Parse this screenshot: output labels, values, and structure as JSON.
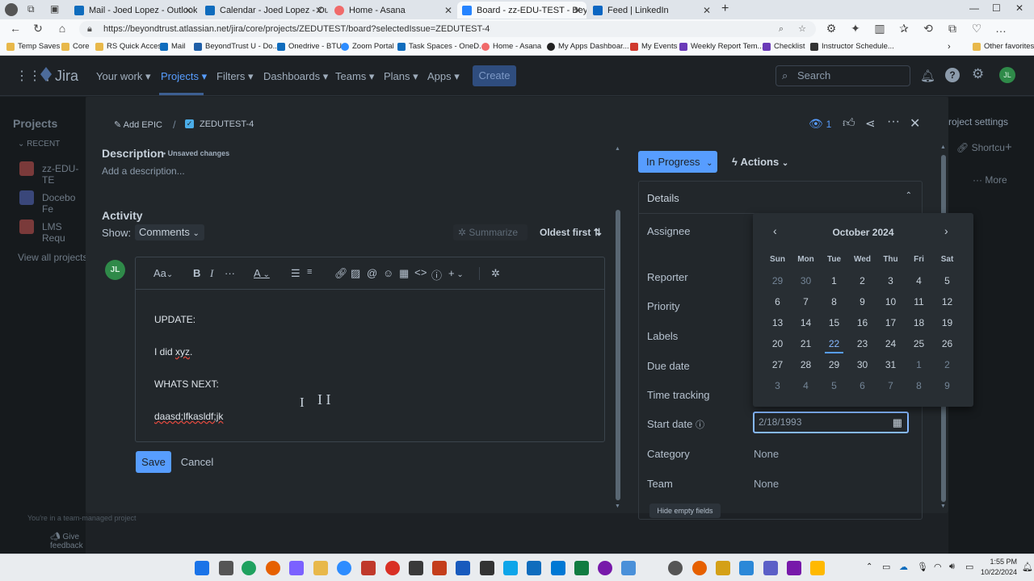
{
  "browser": {
    "tabs": [
      {
        "label": "Mail - Joed Lopez - Outlook",
        "color": "#0f6cbd"
      },
      {
        "label": "Calendar - Joed Lopez - Outlook",
        "color": "#0f6cbd"
      },
      {
        "label": "Home - Asana",
        "color": "#f06a6a"
      },
      {
        "label": "Board - zz-EDU-TEST - BeyondTr",
        "color": "#2684ff"
      },
      {
        "label": "Feed | LinkedIn",
        "color": "#0a66c2"
      }
    ],
    "url": "https://beyondtrust.atlassian.net/jira/core/projects/ZEDUTEST/board?selectedIssue=ZEDUTEST-4",
    "bookmarks": [
      "Temp Saves",
      "Core",
      "RS Quick Access",
      "Mail",
      "BeyondTrust U - Do...",
      "Onedrive - BTU",
      "Zoom Portal",
      "Task Spaces - OneD...",
      "Home - Asana",
      "My Apps Dashboar...",
      "My Events",
      "Weekly Report Tem...",
      "Checklist",
      "Instructor Schedule...",
      "Other favorites"
    ]
  },
  "jira": {
    "logo": "Jira",
    "nav": [
      "Your work",
      "Projects",
      "Filters",
      "Dashboards",
      "Teams",
      "Plans",
      "Apps"
    ],
    "create_label": "Create",
    "search_placeholder": "Search",
    "avatar": "JL"
  },
  "sidebar": {
    "title": "Projects",
    "recent": "RECENT",
    "items": [
      "zz-EDU-TE",
      "Docebo Fe",
      "LMS Requ"
    ],
    "view_all": "View all projects",
    "team_note": "You're in a team-managed project",
    "feedback": "Give feedback"
  },
  "right_bg": {
    "settings": "roject settings",
    "shortcut": "Shortcu",
    "more": "More"
  },
  "modal": {
    "breadcrumb_epic": "Add EPIC",
    "breadcrumb_issue": "ZEDUTEST-4",
    "watchers": "1",
    "description_title": "Description",
    "unsaved": "• Unsaved changes",
    "description_placeholder": "Add a description...",
    "activity_title": "Activity",
    "show_label": "Show:",
    "show_value": "Comments",
    "summarize": "Summarize",
    "sort": "Oldest first",
    "commenter_avatar": "JL",
    "editor_text_style": "Aa",
    "comment_lines": [
      "UPDATE:",
      "I did xyz.",
      "WHATS NEXT:",
      "daasd;lfkasldf;jk"
    ],
    "save_label": "Save",
    "cancel_label": "Cancel"
  },
  "panel": {
    "status": "In Progress",
    "actions": "Actions",
    "details": "Details",
    "fields": [
      "Assignee",
      "Reporter",
      "Priority",
      "Labels",
      "Due date",
      "Time tracking",
      "Start date",
      "Category",
      "Team"
    ],
    "start_date_value": "2/18/1993",
    "category_value": "None",
    "team_value": "None",
    "hide_empty": "Hide empty fields"
  },
  "calendar": {
    "month": "October 2024",
    "dow": [
      "Sun",
      "Mon",
      "Tue",
      "Wed",
      "Thu",
      "Fri",
      "Sat"
    ],
    "weeks": [
      [
        "29",
        "30",
        "1",
        "2",
        "3",
        "4",
        "5"
      ],
      [
        "6",
        "7",
        "8",
        "9",
        "10",
        "11",
        "12"
      ],
      [
        "13",
        "14",
        "15",
        "16",
        "17",
        "18",
        "19"
      ],
      [
        "20",
        "21",
        "22",
        "23",
        "24",
        "25",
        "26"
      ],
      [
        "27",
        "28",
        "29",
        "30",
        "31",
        "1",
        "2"
      ],
      [
        "3",
        "4",
        "5",
        "6",
        "7",
        "8",
        "9"
      ]
    ],
    "today": "22"
  },
  "taskbar": {
    "time": "1:55 PM",
    "date": "10/22/2024"
  }
}
